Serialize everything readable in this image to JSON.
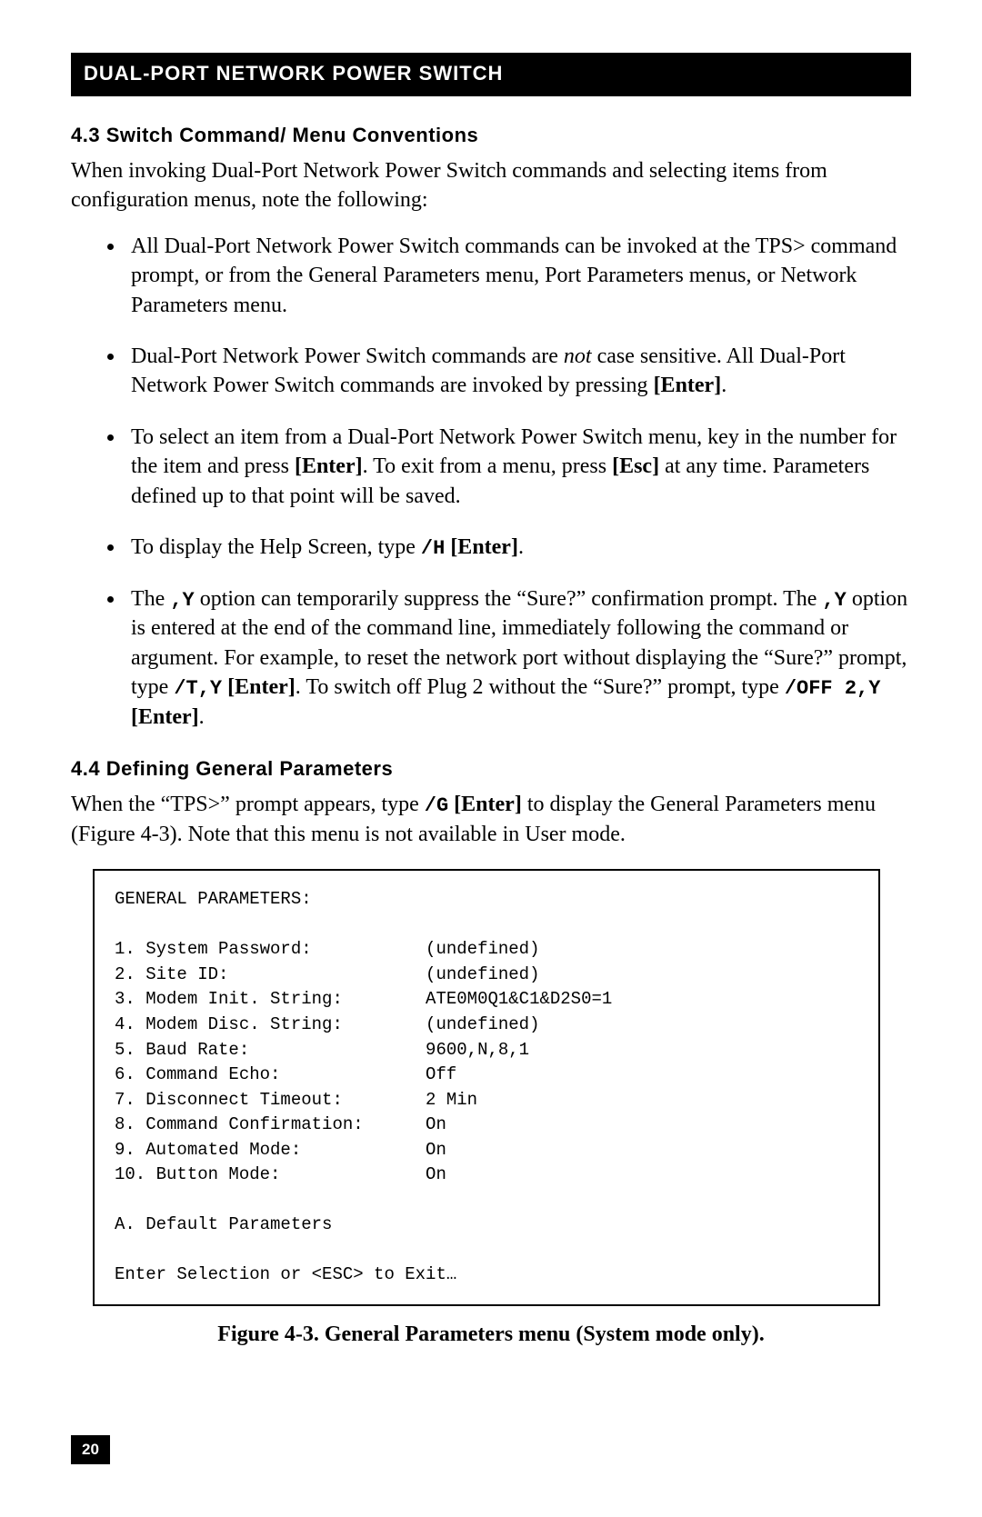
{
  "header": {
    "title": "DUAL-PORT NETWORK POWER SWITCH"
  },
  "section43": {
    "heading": "4.3 Switch Command/ Menu Conventions",
    "intro": "When invoking Dual-Port Network Power Switch commands and selecting items from configuration menus, note the following:",
    "bullets": {
      "b1": "All Dual-Port Network Power Switch commands can be invoked at the TPS> command prompt, or from the General Parameters menu, Port Parameters menus, or Network Parameters menu.",
      "b2_pre": "Dual-Port Network Power Switch commands are ",
      "b2_not": "not",
      "b2_mid": " case sensitive. All Dual-Port Network Power Switch commands are invoked by pressing ",
      "b2_enter": "[Enter]",
      "b2_post": ".",
      "b3_pre": "To select an item from a Dual-Port Network Power Switch menu, key in the number for the item and press ",
      "b3_enter": "[Enter]",
      "b3_mid": ". To exit from a menu, press ",
      "b3_esc": "[Esc]",
      "b3_post": " at any time. Parameters defined up to that point will be saved.",
      "b4_pre": "To display the Help Screen, type ",
      "b4_cmd": "/H",
      "b4_enter": " [Enter]",
      "b4_post": ".",
      "b5_pre": "The ",
      "b5_y1": ",Y",
      "b5_a": " option can temporarily suppress the “Sure?” confirmation prompt. The ",
      "b5_y2": ",Y",
      "b5_b": " option is entered at the end of the command line, immediately following the command or argument. For example, to reset the network port without displaying the “Sure?” prompt, type ",
      "b5_cmd1": "/T,Y",
      "b5_enter1": " [Enter]",
      "b5_c": ". To switch off Plug 2 without the “Sure?” prompt, type ",
      "b5_cmd2": "/OFF 2,Y",
      "b5_enter2": " [Enter]",
      "b5_post": "."
    }
  },
  "section44": {
    "heading": "4.4 Defining General Parameters",
    "intro_pre": "When the “TPS>” prompt appears, type ",
    "intro_cmd": "/G",
    "intro_enter": " [Enter]",
    "intro_post": " to display the General Parameters menu (Figure 4-3). Note that this menu is not available in User mode."
  },
  "figure": {
    "title": "GENERAL PARAMETERS:",
    "rows": [
      {
        "label": "1. System Password:",
        "value": "(undefined)"
      },
      {
        "label": "2. Site ID:",
        "value": "(undefined)"
      },
      {
        "label": "3. Modem Init. String:",
        "value": "ATE0M0Q1&C1&D2S0=1"
      },
      {
        "label": "4. Modem Disc. String:",
        "value": "(undefined)"
      },
      {
        "label": "5. Baud Rate:",
        "value": "9600,N,8,1"
      },
      {
        "label": "6. Command Echo:",
        "value": "Off"
      },
      {
        "label": "7. Disconnect Timeout:",
        "value": "2 Min"
      },
      {
        "label": "8. Command Confirmation:",
        "value": "On"
      },
      {
        "label": "9. Automated Mode:",
        "value": "On"
      },
      {
        "label": "10. Button Mode:",
        "value": "On"
      }
    ],
    "footer1": "A. Default Parameters",
    "footer2": "Enter Selection or <ESC> to Exit…",
    "caption": "Figure 4-3. General Parameters menu (System mode only)."
  },
  "page_number": "20"
}
